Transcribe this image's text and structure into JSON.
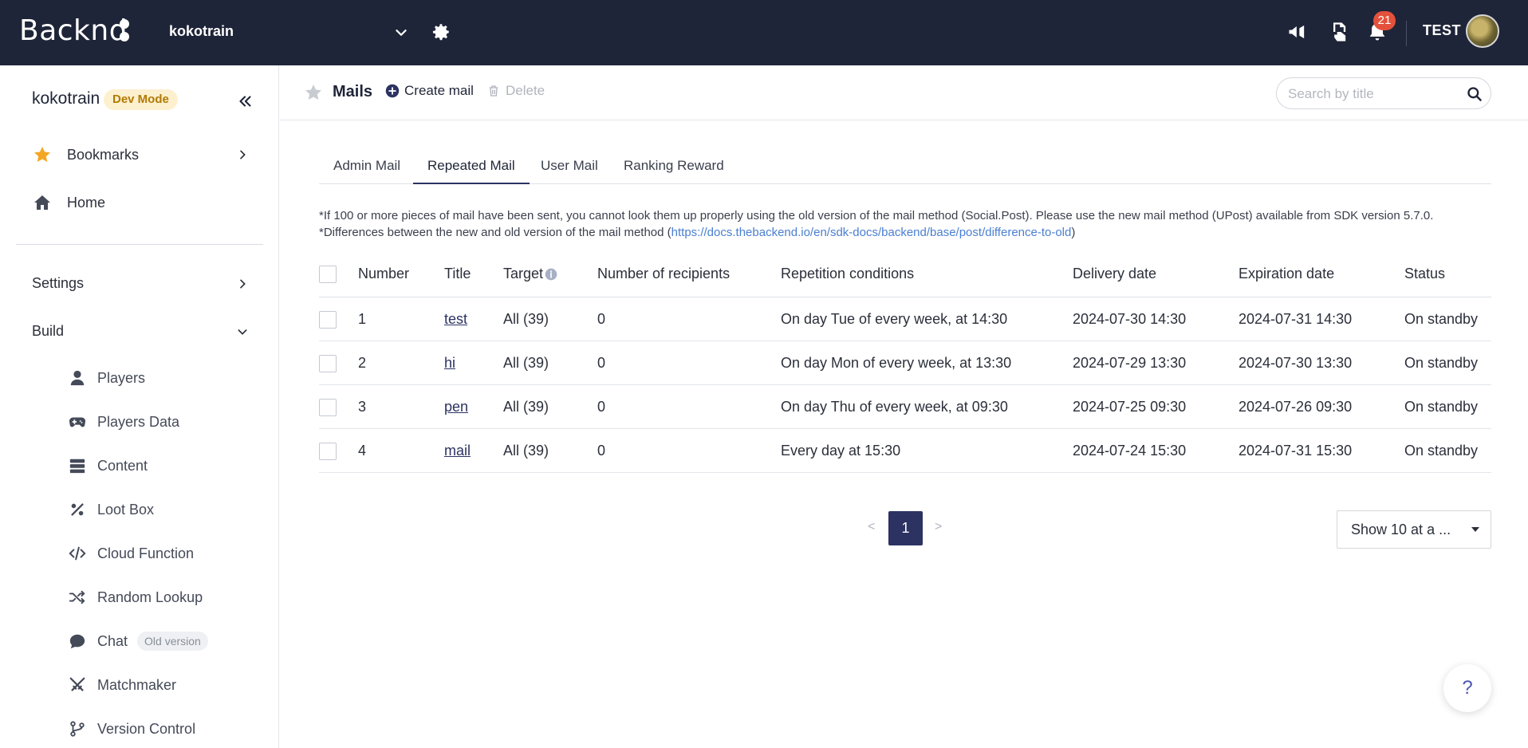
{
  "topbar": {
    "logo": "Backnd",
    "project": "kokotrain",
    "notification_count": "21",
    "user": "TEST"
  },
  "sidebar": {
    "project": "kokotrain",
    "mode_badge": "Dev Mode",
    "bookmarks": "Bookmarks",
    "home": "Home",
    "settings": "Settings",
    "build": "Build",
    "build_items": [
      {
        "label": "Players",
        "icon": "user-icon"
      },
      {
        "label": "Players Data",
        "icon": "gamepad-icon"
      },
      {
        "label": "Content",
        "icon": "list-icon"
      },
      {
        "label": "Loot Box",
        "icon": "percent-icon"
      },
      {
        "label": "Cloud Function",
        "icon": "code-icon"
      },
      {
        "label": "Random Lookup",
        "icon": "shuffle-icon"
      },
      {
        "label": "Chat",
        "icon": "chat-icon",
        "badge": "Old version"
      },
      {
        "label": "Matchmaker",
        "icon": "swords-icon"
      },
      {
        "label": "Version Control",
        "icon": "branch-icon"
      }
    ]
  },
  "header": {
    "title": "Mails",
    "create": "Create mail",
    "delete": "Delete",
    "search_placeholder": "Search by title"
  },
  "tabs": [
    "Admin Mail",
    "Repeated Mail",
    "User Mail",
    "Ranking Reward"
  ],
  "active_tab": "Repeated Mail",
  "notice": {
    "line1": "*If 100 or more pieces of mail have been sent, you cannot look them up properly using the old version of the mail method (Social.Post). Please use the new mail method (UPost) available from SDK version 5.7.0.",
    "line2_prefix": "*Differences between the new and old version of the mail method (",
    "line2_link": "https://docs.thebackend.io/en/sdk-docs/backend/base/post/difference-to-old",
    "line2_suffix": ")"
  },
  "table": {
    "headers": [
      "Number",
      "Title",
      "Target",
      "Number of recipients",
      "Repetition conditions",
      "Delivery date",
      "Expiration date",
      "Status"
    ],
    "rows": [
      {
        "number": "1",
        "title": "test",
        "target": "All (39)",
        "recipients": "0",
        "repetition": "On day Tue of every week, at 14:30",
        "delivery": "2024-07-30 14:30",
        "expiration": "2024-07-31 14:30",
        "status": "On standby"
      },
      {
        "number": "2",
        "title": "hi",
        "target": "All (39)",
        "recipients": "0",
        "repetition": "On day Mon of every week, at 13:30",
        "delivery": "2024-07-29 13:30",
        "expiration": "2024-07-30 13:30",
        "status": "On standby"
      },
      {
        "number": "3",
        "title": "pen",
        "target": "All (39)",
        "recipients": "0",
        "repetition": "On day Thu of every week, at 09:30",
        "delivery": "2024-07-25 09:30",
        "expiration": "2024-07-26 09:30",
        "status": "On standby"
      },
      {
        "number": "4",
        "title": "mail",
        "target": "All (39)",
        "recipients": "0",
        "repetition": "Every day at 15:30",
        "delivery": "2024-07-24 15:30",
        "expiration": "2024-07-31 15:30",
        "status": "On standby"
      }
    ]
  },
  "pagination": {
    "prev": "<",
    "current": "1",
    "next": ">",
    "page_size": "Show 10 at a ..."
  },
  "help": "?",
  "colors": {
    "topbar": "#1f2538",
    "accent": "#2c3261",
    "badge": "#e4513b",
    "star": "#f5a623",
    "dev_mode_bg": "#fdf0cf"
  }
}
